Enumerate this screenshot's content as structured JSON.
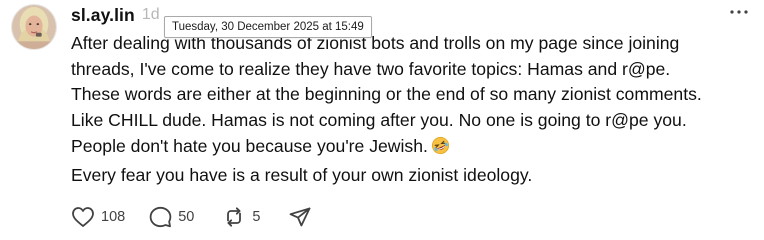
{
  "post": {
    "username": "sl.ay.lin",
    "time": "1d",
    "tooltip": "Tuesday, 30 December 2025 at 15:49",
    "lines": [
      "After dealing with thousands of zionist bots and trolls on my page since joining",
      "threads, I've come to realize they have two favorite topics: Hamas and r@pe.",
      "These words are either at the beginning or the end of so many zionist comments.",
      "Like CHILL dude. Hamas is not coming after you. No one is going to r@pe you.",
      "People don't hate you because you're Jewish.",
      "Every fear you have is a result of your own zionist ideology."
    ],
    "emoji": "rolling-on-floor-laughing-emoji"
  },
  "actions": {
    "likes": "108",
    "replies": "50",
    "reposts": "5"
  },
  "icons": {
    "like": "heart-icon",
    "reply": "comment-icon",
    "repost": "repost-icon",
    "share": "send-icon",
    "more": "more-horizontal-icon"
  },
  "colors": {
    "text": "#101010",
    "muted": "#b8b8b8",
    "icon": "#424242"
  }
}
